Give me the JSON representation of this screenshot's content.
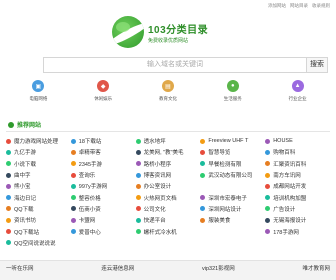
{
  "header": {
    "links": [
      "添加网站",
      "网站目录",
      "收录规则"
    ]
  },
  "logo": {
    "title": "103分类目录",
    "subtitle": "免费收录优质网站"
  },
  "search": {
    "placeholder": "输入域名或关键词",
    "button": "搜索"
  },
  "quick_links": [
    {
      "label": "电脑网络",
      "icon": "computer-icon",
      "color": "#4a9de0"
    },
    {
      "label": "休闲娱乐",
      "icon": "game-icon",
      "color": "#e0574a"
    },
    {
      "label": "教育文化",
      "icon": "book-icon",
      "color": "#e0a84a"
    },
    {
      "label": "生活服务",
      "icon": "service-icon",
      "color": "#5ab54a"
    },
    {
      "label": "行业企业",
      "icon": "building-icon",
      "color": "#9b6ae0"
    }
  ],
  "section": {
    "title": "推荐网站"
  },
  "sites": [
    "魔力游戏网站处理",
    "18下载站",
    "透水地坪",
    "Freeview UHF T",
    "HOUSE",
    "九亿手游",
    "卓精带客",
    "龙美网, \"教\"美毛",
    "智慧导览",
    "购物百科",
    "小说下载",
    "2345手游",
    "路桥小程序",
    "早餐检测有限",
    "汇聚资讯百科",
    "曲中字",
    "查询乐",
    "博客资讯网",
    "武汉动态有限公司",
    "南方车讯网",
    "熊小宝",
    "997y手游网",
    "办公室设计",
    "",
    "成都网站开发",
    "海边日记",
    "整容价格",
    "火热网页文档",
    "深圳市宏泰电子",
    "培训机构加盟",
    "QQ下载",
    "伍商小资",
    "公司文化",
    "深圳网站设计",
    "广告设计",
    "资讯书坊",
    "卡盟网",
    "快递平台",
    "服装美食",
    "无锡海报设计",
    "QQ下载站",
    "爱普中心",
    "螺杆式冷水机",
    "",
    "178手游网",
    "QQ空间说说说说",
    "",
    "",
    "",
    ""
  ],
  "footer": {
    "links": [
      "一听在乐网",
      "连云港信息网",
      "vip321影视网",
      "唯才教育网"
    ]
  }
}
